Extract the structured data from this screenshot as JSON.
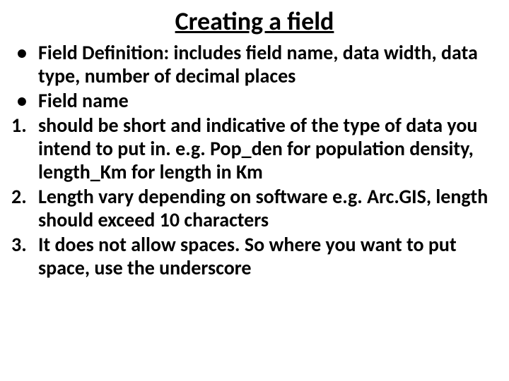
{
  "title": "Creating a field",
  "bullets": [
    "Field Definition: includes field name, data width, data type, number of decimal places",
    "Field name"
  ],
  "numbers": [
    "should be short and indicative of the type of data you intend to put in. e.g. Pop_den for population density, length_Km for length in Km",
    "Length vary depending on software e.g. Arc.GIS, length should exceed 10 characters",
    "It does not allow spaces. So where you want to put space, use the underscore"
  ]
}
